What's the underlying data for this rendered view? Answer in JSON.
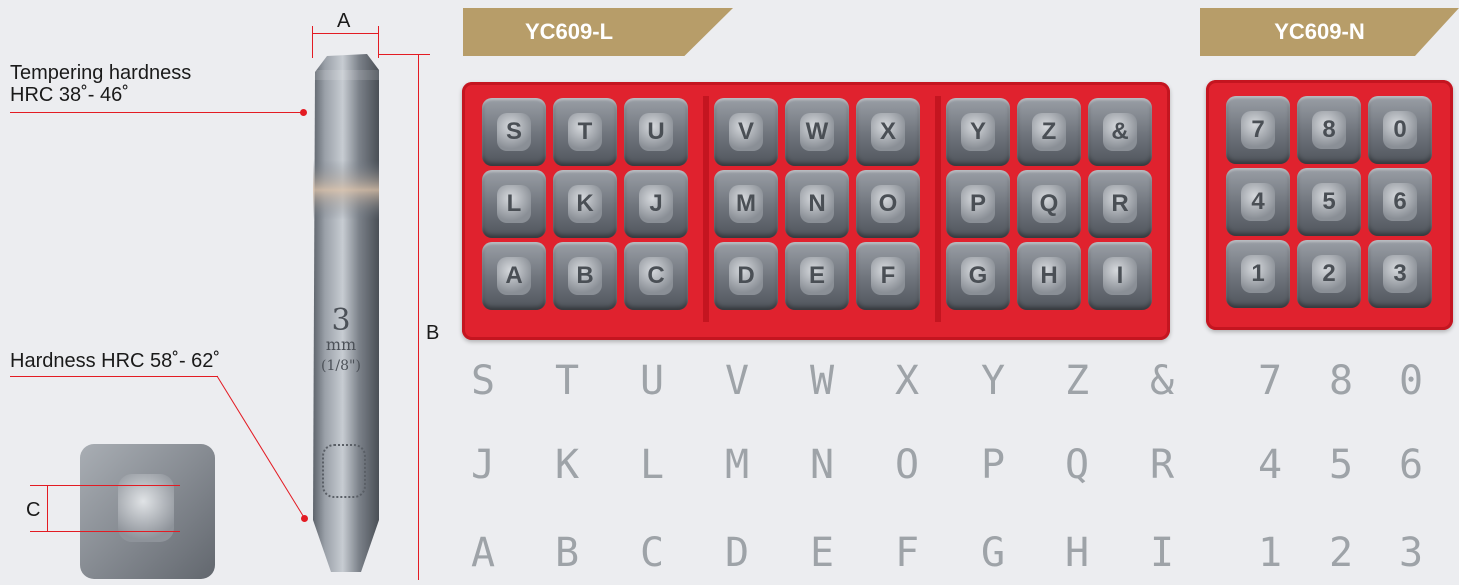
{
  "dimensions": {
    "a": "A",
    "b": "B",
    "c": "C"
  },
  "labels": {
    "tempering_line1": "Tempering hardness",
    "tempering_line2": "HRC 38˚- 46˚",
    "hardness": "Hardness HRC 58˚- 62˚"
  },
  "stamp_body": {
    "size": "3",
    "unit": "mm",
    "fraction": "(1/8\")"
  },
  "banners": {
    "letters": "YC609-L",
    "numbers": "YC609-N"
  },
  "letter_tray": [
    [
      "S",
      "T",
      "U",
      "V",
      "W",
      "X",
      "Y",
      "Z",
      "&"
    ],
    [
      "L",
      "K",
      "J",
      "M",
      "N",
      "O",
      "P",
      "Q",
      "R"
    ],
    [
      "A",
      "B",
      "C",
      "D",
      "E",
      "F",
      "G",
      "H",
      "I"
    ]
  ],
  "number_tray": [
    [
      "7",
      "8",
      "0"
    ],
    [
      "4",
      "5",
      "6"
    ],
    [
      "1",
      "2",
      "3"
    ]
  ],
  "letter_chart": [
    [
      "S",
      "T",
      "U",
      "V",
      "W",
      "X",
      "Y",
      "Z",
      "&"
    ],
    [
      "J",
      "K",
      "L",
      "M",
      "N",
      "O",
      "P",
      "Q",
      "R"
    ],
    [
      "A",
      "B",
      "C",
      "D",
      "E",
      "F",
      "G",
      "H",
      "I"
    ]
  ],
  "number_chart": [
    [
      "7",
      "8",
      "0"
    ],
    [
      "4",
      "5",
      "6"
    ],
    [
      "1",
      "2",
      "3"
    ]
  ],
  "colors": {
    "accent": "#e31b23",
    "banner": "#b79d69",
    "tray": "#e0222e"
  }
}
